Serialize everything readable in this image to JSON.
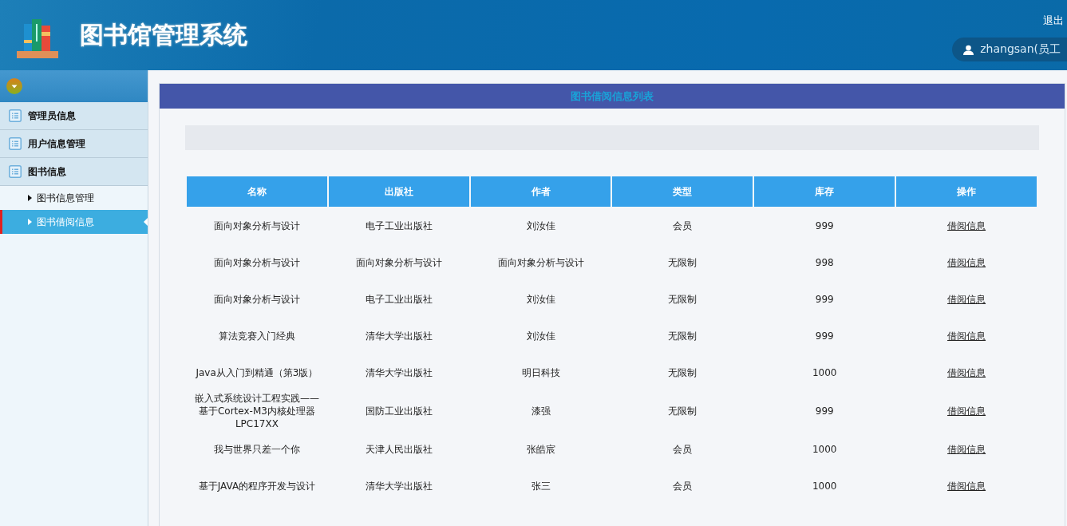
{
  "header": {
    "title": "图书馆管理系统",
    "logout": "退出",
    "user": "zhangsan(员工"
  },
  "sidebar": {
    "groups": [
      {
        "label": "管理员信息"
      },
      {
        "label": "用户信息管理"
      },
      {
        "label": "图书信息",
        "children": [
          {
            "label": "图书信息管理",
            "selected": false
          },
          {
            "label": "图书借阅信息",
            "selected": true
          }
        ]
      }
    ]
  },
  "panel": {
    "title": "图书借阅信息列表"
  },
  "table": {
    "columns": [
      "名称",
      "出版社",
      "作者",
      "类型",
      "库存",
      "操作"
    ],
    "rows": [
      [
        "面向对象分析与设计",
        "电子工业出版社",
        "刘汝佳",
        "会员",
        "999",
        "借阅信息"
      ],
      [
        "面向对象分析与设计",
        "面向对象分析与设计",
        "面向对象分析与设计",
        "无限制",
        "998",
        "借阅信息"
      ],
      [
        "面向对象分析与设计",
        "电子工业出版社",
        "刘汝佳",
        "无限制",
        "999",
        "借阅信息"
      ],
      [
        "算法竞赛入门经典",
        "清华大学出版社",
        "刘汝佳",
        "无限制",
        "999",
        "借阅信息"
      ],
      [
        "Java从入门到精通（第3版）",
        "清华大学出版社",
        "明日科技",
        "无限制",
        "1000",
        "借阅信息"
      ],
      [
        "嵌入式系统设计工程实践——基于Cortex-M3内核处理器LPC17XX",
        "国防工业出版社",
        "漆强",
        "无限制",
        "999",
        "借阅信息"
      ],
      [
        "我与世界只差一个你",
        "天津人民出版社",
        "张皓宸",
        "会员",
        "1000",
        "借阅信息"
      ],
      [
        "基于JAVA的程序开发与设计",
        "清华大学出版社",
        "张三",
        "会员",
        "1000",
        "借阅信息"
      ]
    ]
  }
}
